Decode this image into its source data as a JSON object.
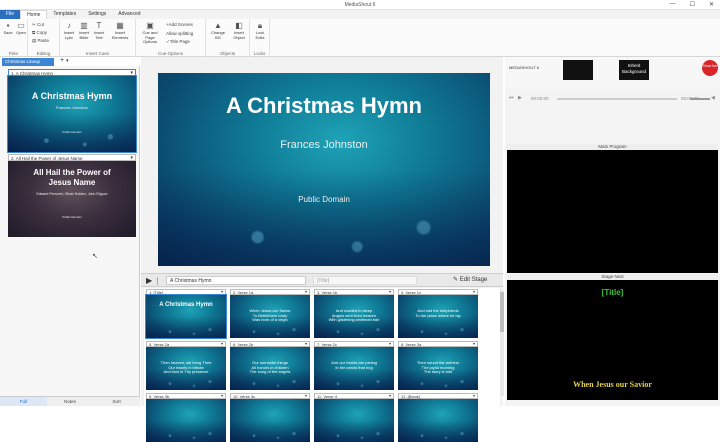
{
  "window": {
    "title": "MediaShout 6",
    "buttons": [
      "—",
      "☐",
      "✕"
    ]
  },
  "menu": [
    "File",
    "Home",
    "Templates",
    "Settings",
    "Advanced"
  ],
  "ribbon": {
    "save": "Save",
    "open": "Open",
    "cut": "Cut",
    "copy": "Copy",
    "paste": "Paste",
    "insert_lyric": "Insert Lyric",
    "insert_bible": "Insert Bible",
    "insert_text": "Insert Text",
    "insert_elements": "Insert Elements",
    "cue_options": "Cue and Page Options",
    "add_scenes": "Add Scenes",
    "allow_splitting": "Allow splitting",
    "title_page": "Title Page",
    "change_bg": "Change BG",
    "insert_object": "Insert Object",
    "lock_edits": "Lock Edits",
    "groups": [
      "Files",
      "Editing",
      "Insert Cues",
      "Cue Options",
      "Objects",
      "Locks"
    ]
  },
  "doc_tab": "Christmas Lineup",
  "docs": [
    {
      "header": "1. A Christmas Hymn",
      "title": "A Christmas Hymn",
      "author": "Frances Johnston",
      "footer": "Public Domain"
    },
    {
      "header": "2. All Hail the Power of Jesus Name",
      "title": "All Hail the Power of Jesus Name",
      "author": "Edward Perronet, Oliver Holden, John Rippon",
      "footer": "Public Domain"
    }
  ],
  "left_tabs": [
    "Full",
    "Notes",
    "Sort"
  ],
  "preview": {
    "title": "A Christmas Hymn",
    "author": "Frances Johnston",
    "footer": "Public Domain"
  },
  "controls": {
    "doc_name": "A Christmas Hymn",
    "slide_label": "[Title]",
    "edit_stage": "Edit Stage"
  },
  "slides": [
    {
      "label": "1. [Title]",
      "text": "A Christmas Hymn"
    },
    {
      "label": "2. Verse 1a",
      "text": "When Jesus our Savior\nTo Bethlehem lowly\nWas born of a virgin"
    },
    {
      "label": "3. Verse 1b",
      "text": "And cradled to sleep\nAngels sent from heaven\nWith glistening whitened tide"
    },
    {
      "label": "4. Verse 1c",
      "text": "And told the shepherds\nTo the place where he lay"
    },
    {
      "label": "5. Verse 2a",
      "text": "Then heaven, we bring Thee\nOur hearts in tribute\nAnd bow in Thy presence"
    },
    {
      "label": "6. Verse 2b",
      "text": "Our sorrowful things\nAll honors in children\nThe song of the angels"
    },
    {
      "label": "7. Verse 2c",
      "text": "And our hearts are joining\nIn the carols that ring"
    },
    {
      "label": "8. Verse 3a",
      "text": "Then sound the anthem\nThe joyful morning\nThe story is told"
    },
    {
      "label": "9. Verse 3b",
      "text": ""
    },
    {
      "label": "10. Verse 3c",
      "text": ""
    },
    {
      "label": "11. Verse 4",
      "text": ""
    },
    {
      "label": "12. [Blank]",
      "text": ""
    }
  ],
  "right": {
    "logo": "MEDIASHOUT 6",
    "inherit_bg": "Inherit Background",
    "live_btn": "Show live",
    "time_left": "00:00:00",
    "time_right": "00:00:00",
    "main_program": "Main Program",
    "stage_next": "Stage Next",
    "stage_title": "[Title]",
    "stage_next_text": "When Jesus our Savior"
  }
}
